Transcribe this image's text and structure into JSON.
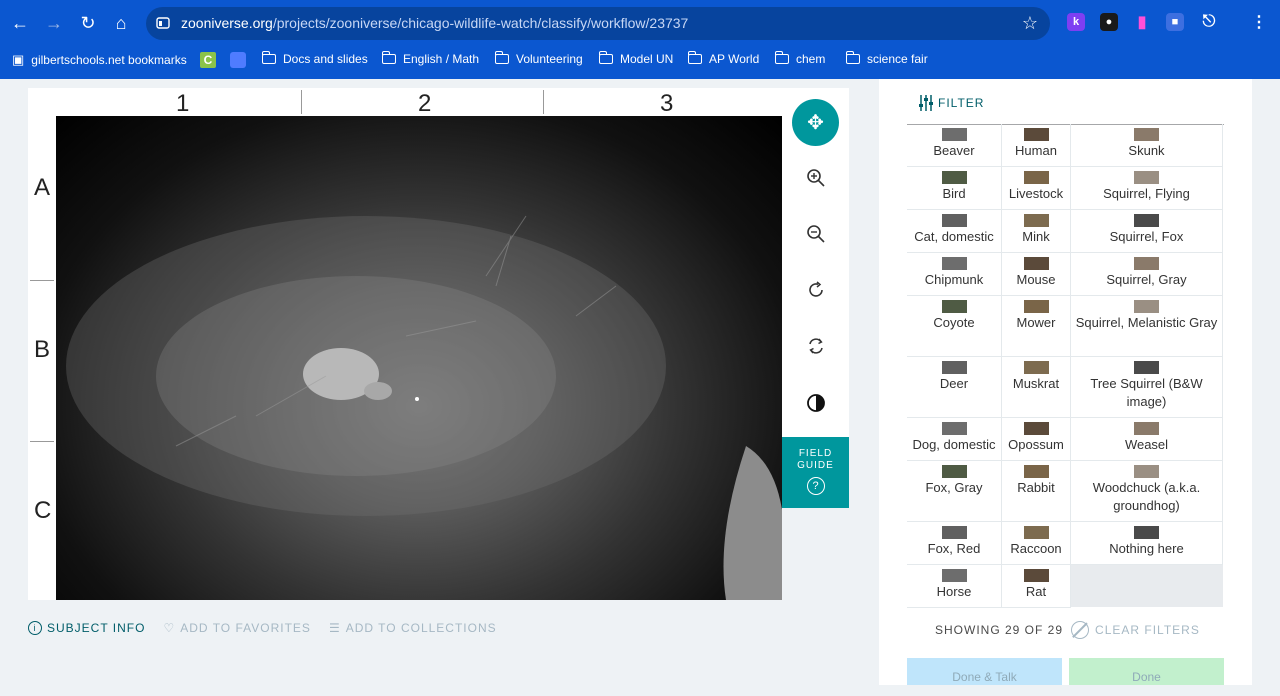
{
  "browser": {
    "url_host": "zooniverse.org",
    "url_path": "/projects/zooniverse/chicago-wildlife-watch/classify/workflow/23737",
    "extensions": [
      "k",
      "",
      "",
      "",
      ""
    ],
    "bookmarks": [
      {
        "label": "gilbertschools.net bookmarks",
        "icon": "managed-bookmarks-icon"
      },
      {
        "label": "",
        "icon": "c-icon"
      },
      {
        "label": "",
        "icon": "app-icon"
      },
      {
        "label": "Docs and slides",
        "icon": "folder-icon"
      },
      {
        "label": "English / Math",
        "icon": "folder-icon"
      },
      {
        "label": "Volunteering",
        "icon": "folder-icon"
      },
      {
        "label": "Model UN",
        "icon": "folder-icon"
      },
      {
        "label": "AP World",
        "icon": "folder-icon"
      },
      {
        "label": "chem",
        "icon": "folder-icon"
      },
      {
        "label": "science fair",
        "icon": "folder-icon"
      }
    ]
  },
  "viewer": {
    "columns": [
      "1",
      "2",
      "3"
    ],
    "rows": [
      "A",
      "B",
      "C"
    ],
    "field_guide_label": "FIELD GUIDE",
    "field_guide_q": "?"
  },
  "meta_actions": {
    "subject_info": "SUBJECT INFO",
    "favorites": "ADD TO FAVORITES",
    "collections": "ADD TO COLLECTIONS"
  },
  "panel": {
    "filter_label": "FILTER",
    "species": [
      [
        "Beaver",
        "Human",
        "Skunk"
      ],
      [
        "Bird",
        "Livestock",
        "Squirrel, Flying"
      ],
      [
        "Cat, domestic",
        "Mink",
        "Squirrel, Fox"
      ],
      [
        "Chipmunk",
        "Mouse",
        "Squirrel, Gray"
      ],
      [
        "Coyote",
        "Mower",
        "Squirrel, Melanistic Gray"
      ],
      [
        "Deer",
        "Muskrat",
        "Tree Squirrel (B&W image)"
      ],
      [
        "Dog, domestic",
        "Opossum",
        "Weasel"
      ],
      [
        "Fox, Gray",
        "Rabbit",
        "Woodchuck (a.k.a. groundhog)"
      ],
      [
        "Fox, Red",
        "Raccoon",
        "Nothing here"
      ],
      [
        "Horse",
        "Rat"
      ]
    ],
    "showing": "SHOWING 29 OF 29",
    "clear_filters": "CLEAR FILTERS",
    "done_talk": "Done & Talk",
    "done": "Done"
  },
  "colors": {
    "accent": "#00979d",
    "chrome": "#0b57d0"
  }
}
